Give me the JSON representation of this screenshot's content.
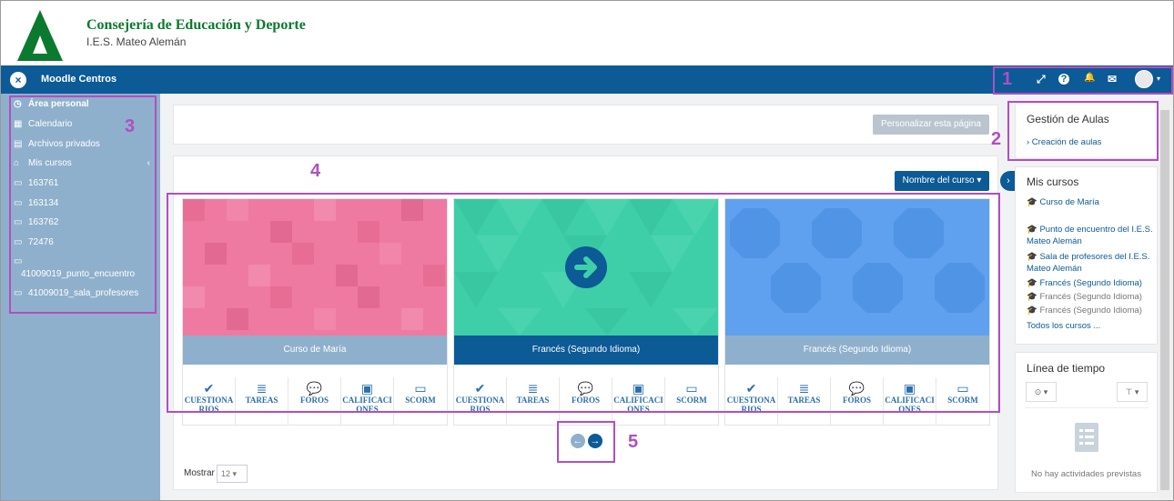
{
  "header": {
    "org": "Consejería de Educación y Deporte",
    "school": "I.E.S. Mateo Alemán"
  },
  "navbar": {
    "brand": "Moodle Centros",
    "close_icon": "×",
    "expand_icon": "⤢",
    "help_icon": "?",
    "bell_icon": "🔔",
    "mail_icon": "✉",
    "caret": "▾"
  },
  "drawer": {
    "items": [
      {
        "icon": "◷",
        "label": "Área personal"
      },
      {
        "icon": "▦",
        "label": "Calendario"
      },
      {
        "icon": "▤",
        "label": "Archivos privados"
      },
      {
        "icon": "⌂",
        "label": "Mis cursos",
        "caret": "‹"
      },
      {
        "icon": "▭",
        "label": "163761"
      },
      {
        "icon": "▭",
        "label": "163134"
      },
      {
        "icon": "▭",
        "label": "163762"
      },
      {
        "icon": "▭",
        "label": "72476"
      },
      {
        "icon": "▭",
        "label": "41009019_punto_encuentro"
      },
      {
        "icon": "▭",
        "label": "41009019_sala_profesores"
      }
    ]
  },
  "main": {
    "customize_button": "Personalizar esta página",
    "sort_button": "Nombre del curso ▾",
    "courses": [
      {
        "name": "Curso de María",
        "color": "#ef7aa1"
      },
      {
        "name": "Francés (Segundo Idioma)",
        "color": "#3ecfa8"
      },
      {
        "name": "Francés (Segundo Idioma)",
        "color": "#5fa1ef"
      }
    ],
    "activities": [
      {
        "icon": "✔",
        "label": "CUESTIONARIOS"
      },
      {
        "icon": "≣",
        "label": "TAREAS"
      },
      {
        "icon": "💬",
        "label": "FOROS"
      },
      {
        "icon": "▣",
        "label": "CALIFICACIONES"
      },
      {
        "icon": "▭",
        "label": "SCORM"
      }
    ],
    "pager": {
      "prev": "←",
      "next": "→"
    },
    "show_label": "Mostrar",
    "show_value": "12 ▾"
  },
  "callouts": {
    "n1": "1",
    "n2": "2",
    "n3": "3",
    "n4": "4",
    "n5": "5"
  },
  "right": {
    "aulas_title": "Gestión de Aulas",
    "aulas_link": "› Creación de aulas",
    "mis_title": "Mis cursos",
    "mis_items": [
      "🎓 Curso de María",
      "🎓 Punto de encuentro del I.E.S. Mateo Alemán",
      "🎓 Sala de profesores del I.E.S. Mateo Alemán",
      "🎓 Francés (Segundo Idioma)",
      "🎓 Francés (Segundo Idioma)",
      "🎓 Francés (Segundo Idioma)",
      "Todos los cursos ..."
    ],
    "timeline_title": "Línea de tiempo",
    "timeline_filter1": "⊙ ▾",
    "timeline_filter2": "⊤ ▾",
    "timeline_empty": "No hay actividades previstas"
  },
  "colors": {
    "navbar": "#0c5a96",
    "callout": "#b04fc1",
    "drawer": "#8fb0cc"
  }
}
